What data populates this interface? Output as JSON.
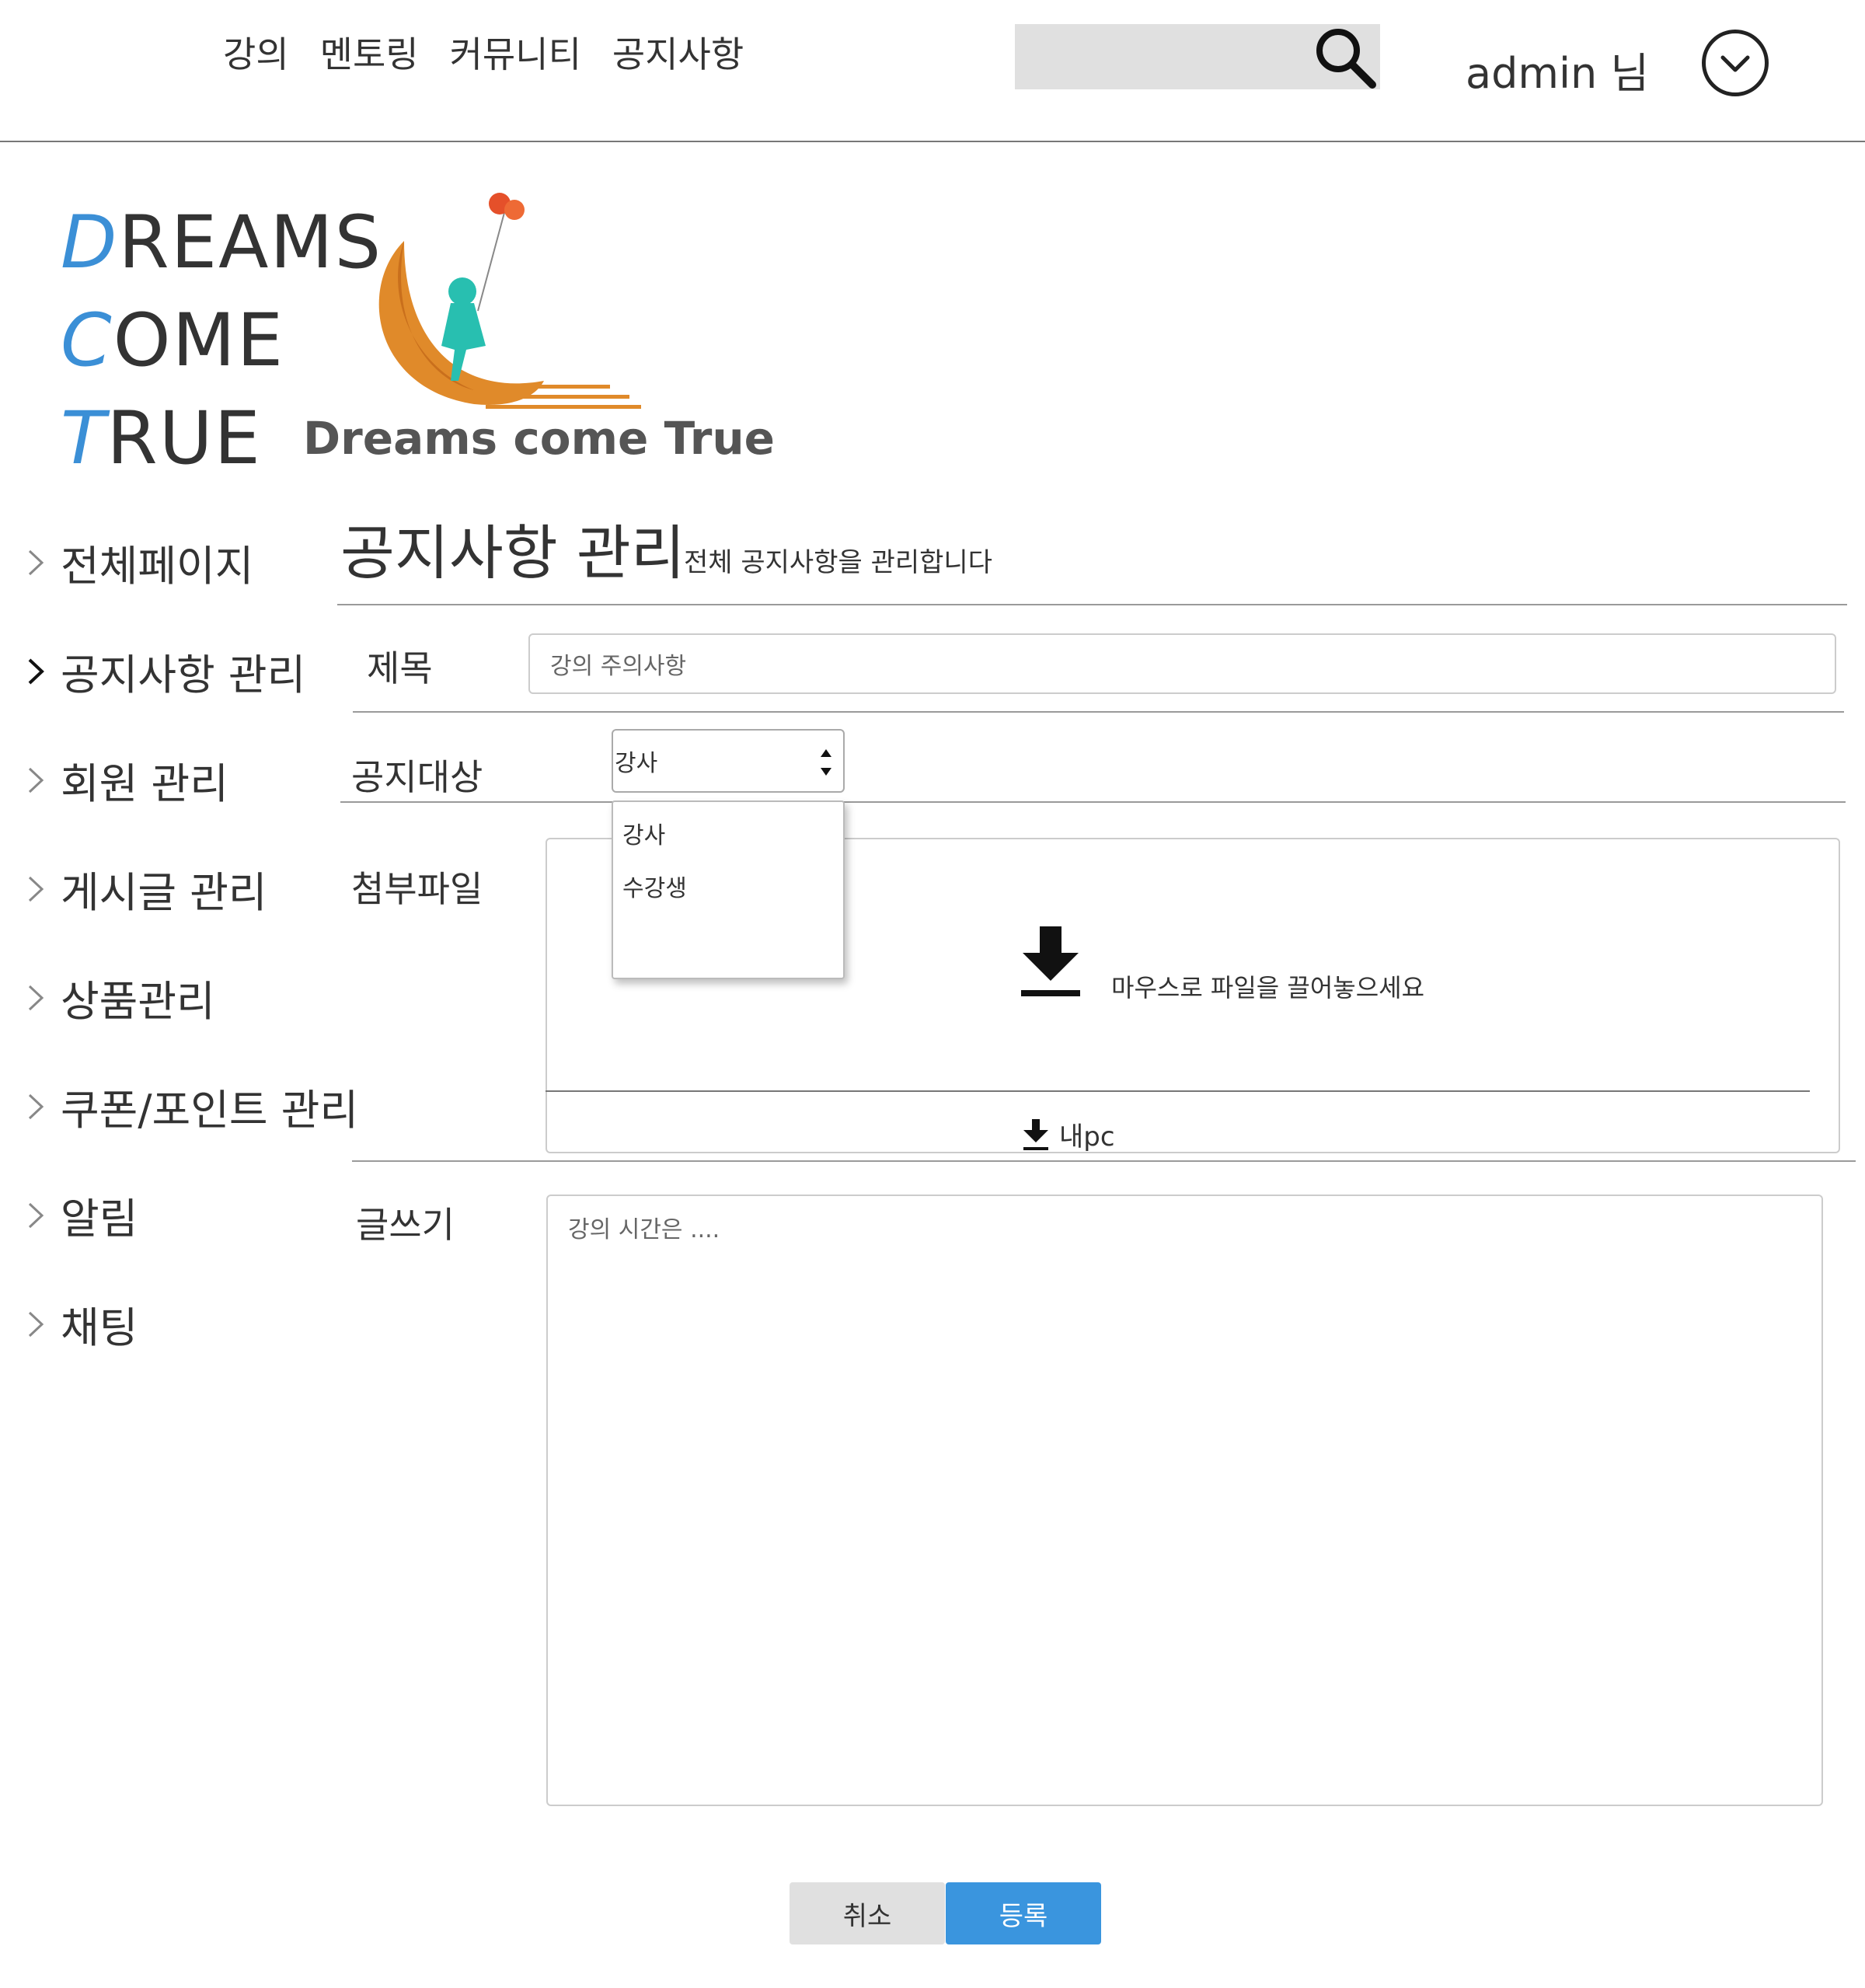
{
  "header": {
    "nav": [
      "강의",
      "멘토링",
      "커뮤니티",
      "공지사항"
    ],
    "search_placeholder": "",
    "username": "admin 님"
  },
  "logo": {
    "lines": [
      {
        "initial": "D",
        "rest": "REAMS"
      },
      {
        "initial": "C",
        "rest": "OME"
      },
      {
        "initial": "T",
        "rest": "RUE"
      }
    ],
    "brand_caption": "Dreams come True"
  },
  "sidebar": {
    "items": [
      {
        "label": "전체페이지",
        "active": false
      },
      {
        "label": "공지사항 관리",
        "active": true
      },
      {
        "label": "회원 관리",
        "active": false
      },
      {
        "label": "게시글 관리",
        "active": false
      },
      {
        "label": "상품관리",
        "active": false
      },
      {
        "label": "쿠폰/포인트 관리",
        "active": false
      },
      {
        "label": "알림",
        "active": false
      },
      {
        "label": "채팅",
        "active": false
      }
    ]
  },
  "page": {
    "title": "공지사항 관리",
    "subtitle": "전체 공지사항을 관리합니다"
  },
  "form": {
    "title_label": "제목",
    "title_placeholder": "강의 주의사항",
    "target_label": "공지대상",
    "target_selected": "강사",
    "target_options": [
      "강사",
      "수강생"
    ],
    "attach_label": "첨부파일",
    "drop_text": "마우스로 파일을 끌어놓으세요",
    "my_pc_label": "내pc",
    "write_label": "글쓰기",
    "write_placeholder": "강의 시간은 ...."
  },
  "buttons": {
    "cancel": "취소",
    "submit": "등록"
  },
  "colors": {
    "accent": "#3a95de",
    "logo_initial": "#3b8fd6",
    "button_gray": "#e0e0e0"
  }
}
